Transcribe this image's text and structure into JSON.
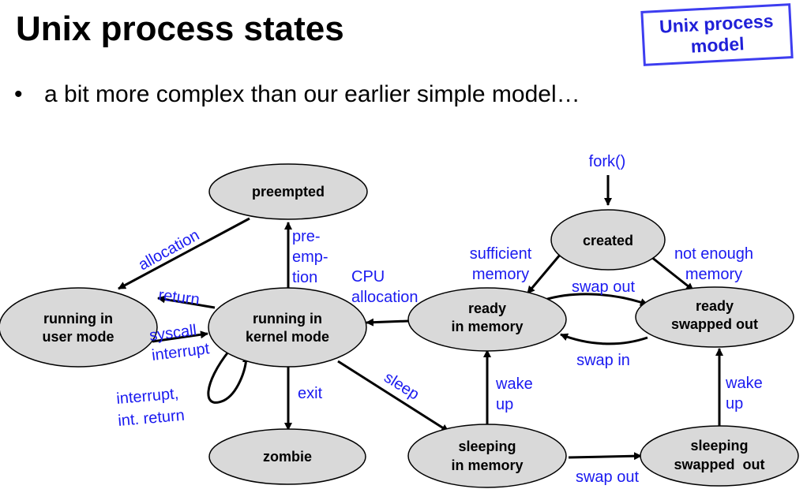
{
  "title": "Unix process states",
  "stamp": {
    "line1": "Unix process",
    "line2": "model"
  },
  "bullet": "a bit more complex than our earlier simple model…",
  "states": {
    "preempted": [
      "preempted"
    ],
    "running_user": [
      "running in",
      "user mode"
    ],
    "running_kernel": [
      "running in",
      "kernel mode"
    ],
    "zombie": [
      "zombie"
    ],
    "ready_memory": [
      "ready",
      "in memory"
    ],
    "ready_swapped": [
      "ready",
      "swapped out"
    ],
    "created": [
      "created"
    ],
    "sleeping_memory": [
      "sleeping",
      "in memory"
    ],
    "sleeping_swapped": [
      "sleeping",
      "swapped  out"
    ]
  },
  "labels": {
    "fork": "fork()",
    "allocation": "allocation",
    "preemption": [
      "pre-",
      "emp-",
      "tion"
    ],
    "cpu_allocation": [
      "CPU",
      "allocation"
    ],
    "sufficient_memory": [
      "sufficient",
      "memory"
    ],
    "not_enough_memory": [
      "not enough",
      "memory"
    ],
    "swap_out_top": "swap out",
    "swap_in": "swap in",
    "return": "return",
    "syscall": "syscall",
    "interrupt": "interrupt",
    "interrupt_return": [
      "interrupt,",
      "int. return"
    ],
    "exit": "exit",
    "sleep": "sleep",
    "wake_up_left": [
      "wake",
      "up"
    ],
    "wake_up_right": [
      "wake",
      "up"
    ],
    "swap_out_bottom": "swap out"
  },
  "colors": {
    "label": "#1a1af0",
    "state_fill": "#d9d9d9",
    "stamp": "#2020d8"
  }
}
